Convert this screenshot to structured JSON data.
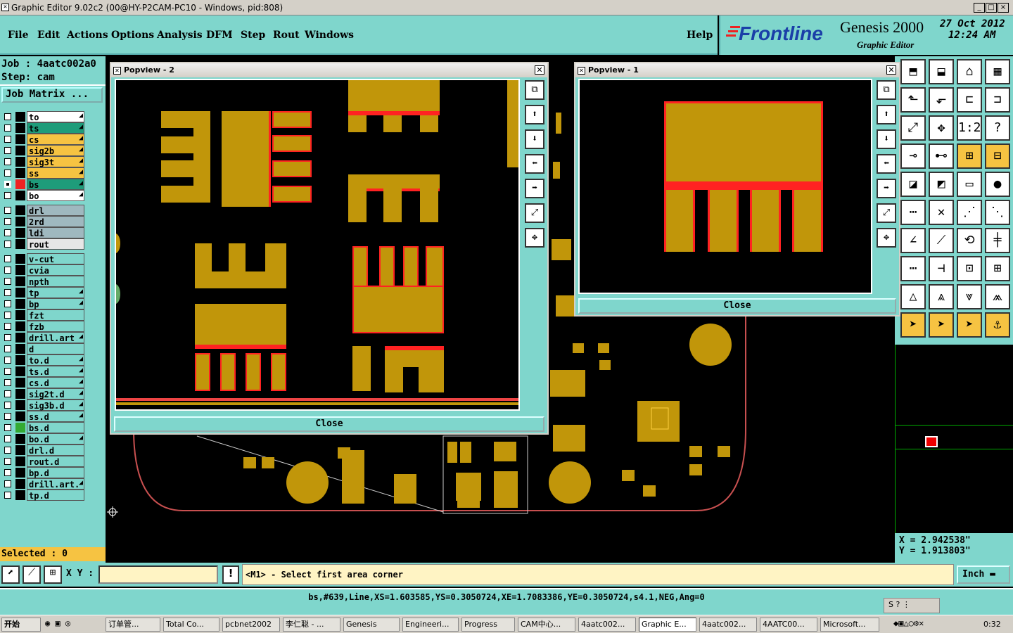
{
  "window": {
    "title": "Graphic Editor 9.02c2 (00@HY-P2CAM-PC10 - Windows, pid:808)",
    "minimize": "_",
    "maximize": "□",
    "close": "×"
  },
  "menu": [
    "File",
    "Edit",
    "Actions",
    "Options",
    "Analysis",
    "DFM",
    "Step",
    "Rout",
    "Windows"
  ],
  "help": "Help",
  "brand": {
    "logo": "Frontline",
    "product": "Genesis 2000",
    "subtitle": "Graphic Editor",
    "date": "27 Oct 2012",
    "time": "12:24 AM"
  },
  "job": {
    "job_label": "Job : 4aatc002a0",
    "step_label": "Step: cam",
    "matrix_button": "Job Matrix ..."
  },
  "layers_group1": [
    {
      "name": "to",
      "color": "#ffffff"
    },
    {
      "name": "ts",
      "color": "#1e9c7a"
    },
    {
      "name": "cs",
      "color": "#f6c342"
    },
    {
      "name": "sig2b",
      "color": "#f6c342"
    },
    {
      "name": "sig3t",
      "color": "#f6c342"
    },
    {
      "name": "ss",
      "color": "#f6c342"
    },
    {
      "name": "bs",
      "color": "#1e9c7a"
    },
    {
      "name": "bo",
      "color": "#ffffff"
    }
  ],
  "layers_group2": [
    {
      "name": "drl",
      "color": "#9fb8bf"
    },
    {
      "name": "2rd",
      "color": "#9fb8bf"
    },
    {
      "name": "ldi",
      "color": "#9fb8bf"
    },
    {
      "name": "rout",
      "color": "#e6e6e6"
    }
  ],
  "layers_group3": [
    "v-cut",
    "cvia",
    "npth",
    "tp",
    "bp",
    "fzt",
    "fzb",
    "drill.art",
    "d",
    "to.d",
    "ts.d",
    "cs.d",
    "sig2t.d",
    "sig3b.d",
    "ss.d",
    "bs.d",
    "bo.d",
    "drl.d",
    "rout.d",
    "bp.d",
    "drill.art.",
    "tp.d"
  ],
  "selected": "Selected : 0",
  "popview2": {
    "title": "Popview - 2",
    "close": "Close"
  },
  "popview1": {
    "title": "Popview - 1",
    "close": "Close"
  },
  "coords": {
    "x": "X = 2.942538\"",
    "y": "Y = 1.913803\""
  },
  "cmd": {
    "xy_label": "X Y :",
    "xy_value": "",
    "prompt": "<M1> - Select first area corner",
    "units": "Inch"
  },
  "status": "bs,#639,Line,XS=1.603585,YS=0.3050724,XE=1.7083386,YE=0.3050724,s4.1,NEG,Ang=0",
  "taskbar": {
    "start": "开始",
    "tasks": [
      "订单管...",
      "Total Co...",
      "pcbnet2002",
      "李仁聪 - ...",
      "Genesis",
      "Engineeri...",
      "Progress",
      "CAM中心...",
      "4aatc002...",
      "Graphic E...",
      "4aatc002...",
      "4AATC00...",
      "Microsoft..."
    ],
    "clock": "0:32"
  }
}
